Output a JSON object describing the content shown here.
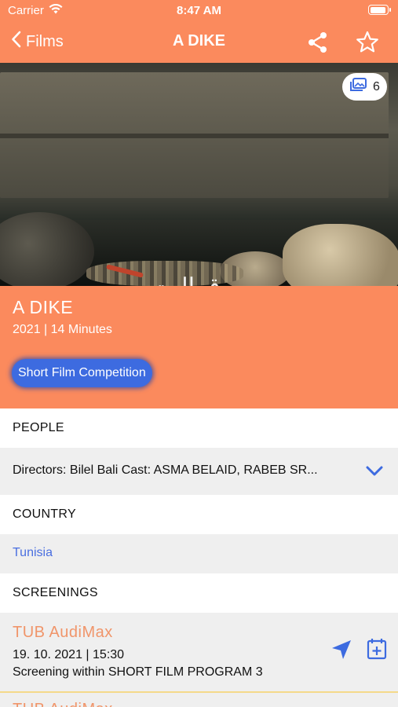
{
  "status_bar": {
    "carrier": "Carrier",
    "time": "8:47 AM"
  },
  "nav": {
    "back_label": "Films",
    "title": "A DIKE"
  },
  "hero": {
    "gallery_count": "6",
    "overlay_text": "ـو ق الـت"
  },
  "film": {
    "title": "A DIKE",
    "meta": "2021 | 14 Minutes",
    "tag": "Short Film Competition"
  },
  "sections": {
    "people": {
      "header": "PEOPLE",
      "text": "Directors:  Bilel Bali  Cast:  ASMA  BELAID, RABEB SR..."
    },
    "country": {
      "header": "COUNTRY",
      "value": "Tunisia"
    },
    "screenings": {
      "header": "SCREENINGS",
      "items": [
        {
          "venue": "TUB AudiMax",
          "datetime": "19. 10. 2021 | 15:30",
          "program": "Screening within SHORT FILM PROGRAM 3"
        },
        {
          "venue": "TUB AudiMax"
        }
      ]
    }
  },
  "colors": {
    "accent": "#fb8a5d",
    "tag": "#3d6be0",
    "link": "#4a6fe0",
    "venue": "#f0956a"
  }
}
